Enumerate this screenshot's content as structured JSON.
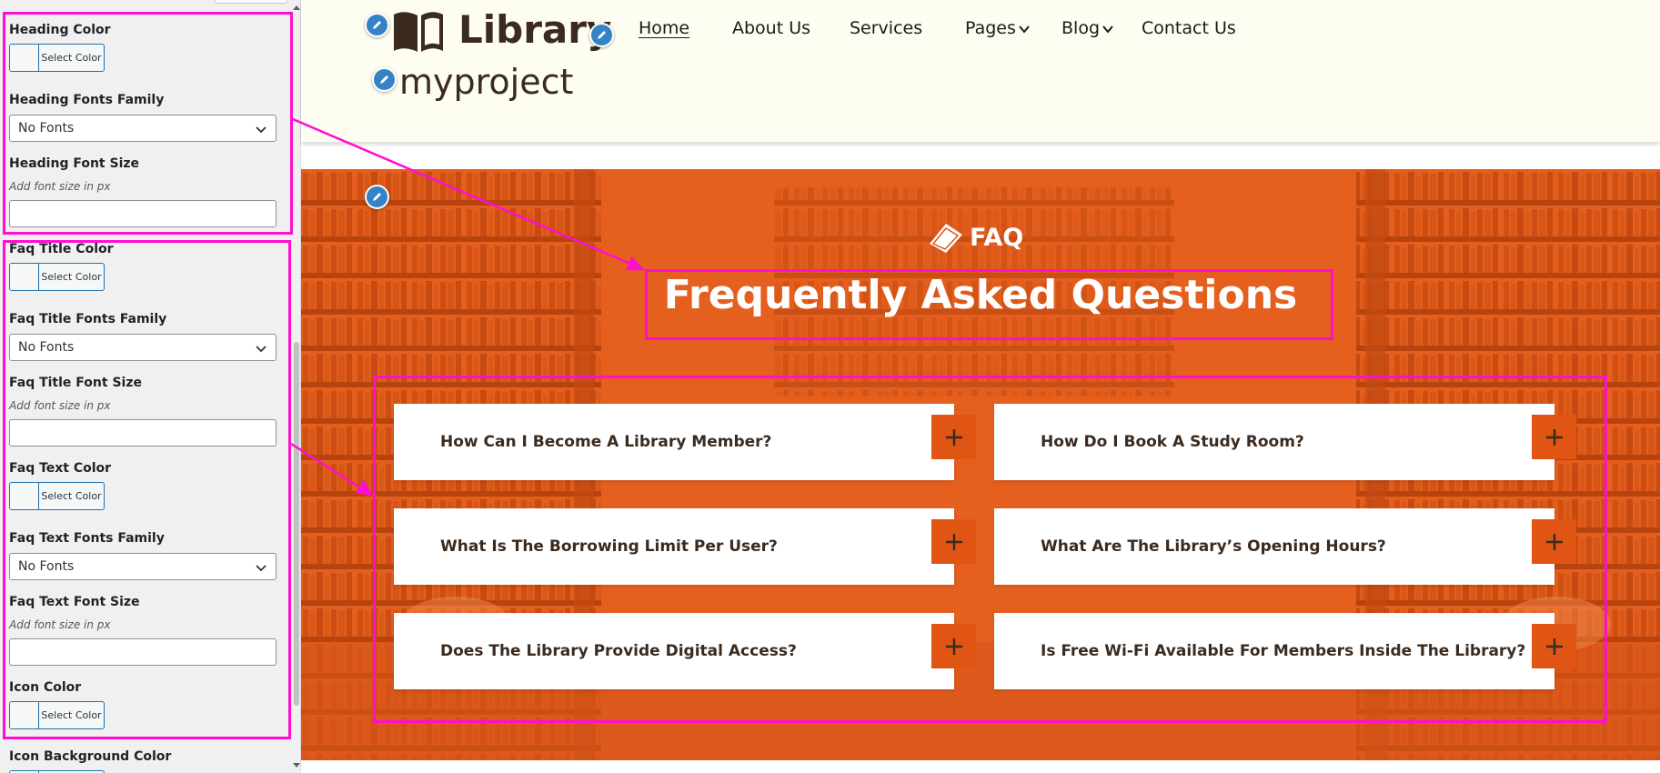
{
  "sidebar": {
    "heading_color": {
      "label": "Heading Color",
      "button": "Select Color"
    },
    "heading_fonts_family": {
      "label": "Heading Fonts Family",
      "value": "No Fonts"
    },
    "heading_font_size": {
      "label": "Heading Font Size",
      "hint": "Add font size in px",
      "value": ""
    },
    "faq_title_color": {
      "label": "Faq Title Color",
      "button": "Select Color"
    },
    "faq_title_fonts_family": {
      "label": "Faq Title Fonts Family",
      "value": "No Fonts"
    },
    "faq_title_font_size": {
      "label": "Faq Title Font Size",
      "hint": "Add font size in px",
      "value": ""
    },
    "faq_text_color": {
      "label": "Faq Text Color",
      "button": "Select Color"
    },
    "faq_text_fonts_family": {
      "label": "Faq Text Fonts Family",
      "value": "No Fonts"
    },
    "faq_text_font_size": {
      "label": "Faq Text Font Size",
      "hint": "Add font size in px",
      "value": ""
    },
    "icon_color": {
      "label": "Icon Color",
      "button": "Select Color"
    },
    "icon_background_color": {
      "label": "Icon Background Color"
    }
  },
  "header": {
    "logo_text": "Library",
    "site_title": "myproject",
    "nav": [
      "Home",
      "About Us",
      "Services",
      "Pages",
      "Blog",
      "Contact Us"
    ],
    "active_nav": "Home"
  },
  "faq": {
    "subtitle": "FAQ",
    "title": "Frequently Asked Questions",
    "items": [
      "How Can I Become A Library Member?",
      "How Do I Book A Study Room?",
      "What Is The Borrowing Limit Per User?",
      "What Are The Library’s Opening Hours?",
      "Does The Library Provide Digital Access?",
      "Is Free Wi-Fi Available For Members Inside The Library?"
    ],
    "icon_symbol": "+"
  },
  "colors": {
    "accent": "#e05514",
    "highlight": "#ff0ed2",
    "header_bg": "#fefdf1",
    "edit_button": "#3582c4",
    "dark_text": "#3b2a1e"
  }
}
